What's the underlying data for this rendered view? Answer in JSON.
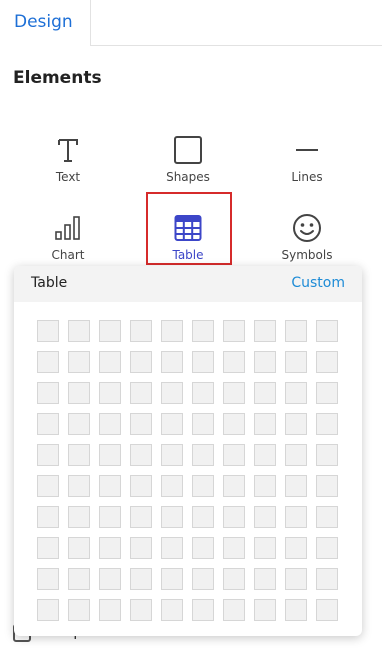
{
  "tabs": {
    "design_label": "Design"
  },
  "section": {
    "title": "Elements"
  },
  "elements": [
    {
      "label": "Text",
      "icon": "text-icon"
    },
    {
      "label": "Shapes",
      "icon": "square-icon"
    },
    {
      "label": "Lines",
      "icon": "line-icon"
    },
    {
      "label": "Chart",
      "icon": "bar-chart-icon"
    },
    {
      "label": "Table",
      "icon": "table-icon",
      "selected": true
    },
    {
      "label": "Symbols",
      "icon": "smiley-icon"
    }
  ],
  "table_popup": {
    "title": "Table",
    "custom_label": "Custom",
    "rows": 10,
    "cols": 10
  },
  "snap": {
    "label": "Snap To Grid",
    "checked": false
  },
  "colors": {
    "accent": "#1d6fd6",
    "selected": "#3c46c8",
    "highlight_border": "#d62b2b"
  }
}
